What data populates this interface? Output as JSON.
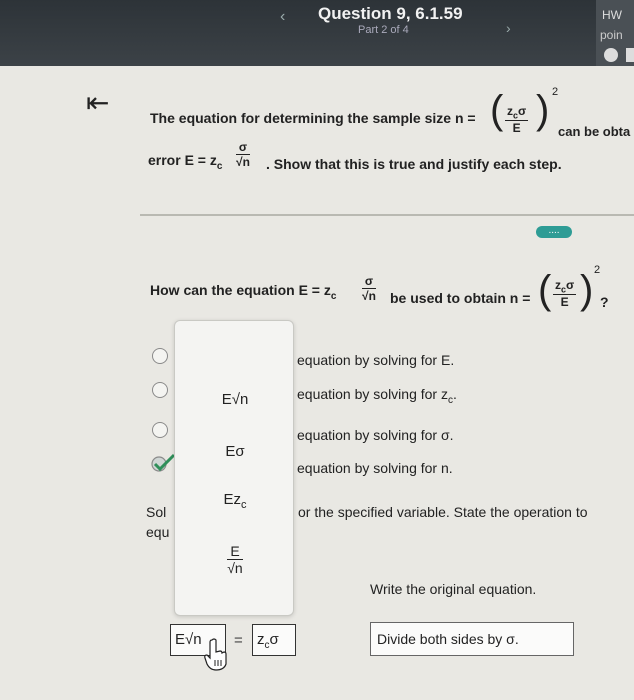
{
  "header": {
    "title": "Question 9, 6.1.59",
    "subtitle": "Part 2 of 4",
    "prev_icon": "chevron-left-icon",
    "next_icon": "chevron-right-icon",
    "hw_label": "HW",
    "points_label": "poin"
  },
  "back_icon": "⇤",
  "statement": {
    "line1_prefix": "The equation for determining the sample size n =",
    "line1_frac_num": "z",
    "line1_frac_num_sub": "c",
    "line1_frac_num_tail": "σ",
    "line1_frac_den": "E",
    "line1_exp": "2",
    "line1_suffix": "can be obta",
    "line2_prefix": "error E = z",
    "line2_sub": "c",
    "line2_frac_num": "σ",
    "line2_frac_den": "√n",
    "line2_suffix": ". Show that this is true and justify each step."
  },
  "more_button": "....",
  "question": {
    "prefix": "How can the equation E = z",
    "sub": "c",
    "frac_num": "σ",
    "frac_den": "√n",
    "middle": "be used to obtain n =",
    "rfrac_num": "z",
    "rfrac_num_sub": "c",
    "rfrac_num_tail": "σ",
    "rfrac_den": "E",
    "exp": "2",
    "suffix": "?"
  },
  "options": [
    {
      "text": "equation by solving for E.",
      "selected": false
    },
    {
      "text": "equation by solving for z",
      "sub": "c",
      "tail": ".",
      "selected": false
    },
    {
      "text": "equation by solving for σ.",
      "selected": false
    },
    {
      "text": "equation by solving for n.",
      "selected": true
    }
  ],
  "popup_tiles": [
    {
      "main": "E√n",
      "sub": ""
    },
    {
      "main": "Eσ",
      "sub": ""
    },
    {
      "main": "Ez",
      "sub": "c"
    },
    {
      "num": "E",
      "den": "√n"
    }
  ],
  "solve": {
    "sol_label": "Sol",
    "equ_label": "equ",
    "specified_text": "or the specified variable. State the operation to",
    "write_original": "Write the original equation."
  },
  "answer": {
    "left": "E√n",
    "equals": "=",
    "right_main": "z",
    "right_sub": "c",
    "right_tail": "σ",
    "operation": "Divide both sides by σ."
  }
}
